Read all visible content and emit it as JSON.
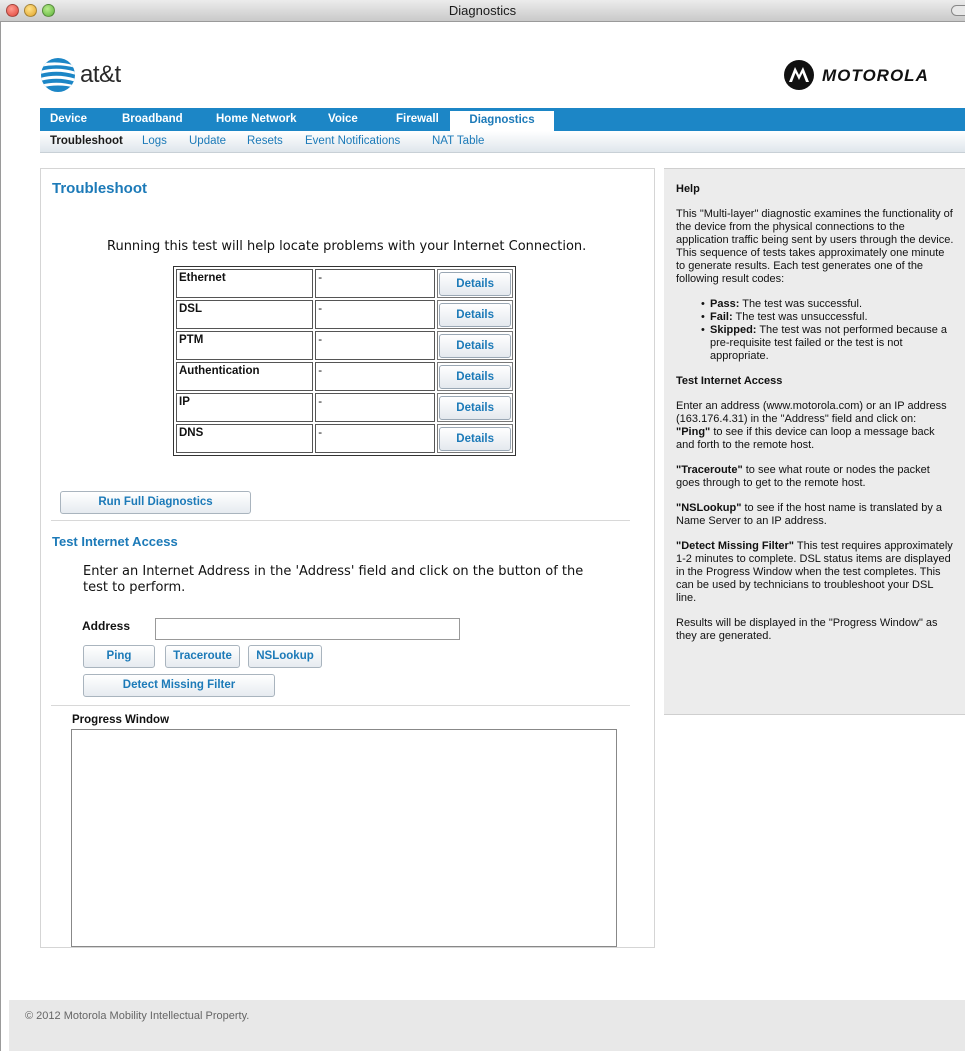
{
  "window": {
    "title": "Diagnostics"
  },
  "header": {
    "att_logo_text": "at&t",
    "motorola_logo_text": "MOTOROLA"
  },
  "nav": {
    "tabs": [
      {
        "label": "Device"
      },
      {
        "label": "Broadband"
      },
      {
        "label": "Home Network"
      },
      {
        "label": "Voice"
      },
      {
        "label": "Firewall"
      },
      {
        "label": "Diagnostics",
        "active": true
      }
    ],
    "subtabs": [
      {
        "label": "Troubleshoot",
        "active": true
      },
      {
        "label": "Logs"
      },
      {
        "label": "Update"
      },
      {
        "label": "Resets"
      },
      {
        "label": "Event Notifications"
      },
      {
        "label": "NAT Table"
      }
    ]
  },
  "main": {
    "title": "Troubleshoot",
    "intro": "Running this test will help locate problems with your Internet Connection.",
    "tests": [
      {
        "name": "Ethernet",
        "status": "-",
        "button": "Details"
      },
      {
        "name": "DSL",
        "status": "-",
        "button": "Details"
      },
      {
        "name": "PTM",
        "status": "-",
        "button": "Details"
      },
      {
        "name": "Authentication",
        "status": "-",
        "button": "Details"
      },
      {
        "name": "IP",
        "status": "-",
        "button": "Details"
      },
      {
        "name": "DNS",
        "status": "-",
        "button": "Details"
      }
    ],
    "run_full_label": "Run Full Diagnostics",
    "test_access": {
      "title": "Test Internet Access",
      "description": "Enter an Internet Address in the 'Address' field and click on the button of the test to perform.",
      "address_label": "Address",
      "address_value": "",
      "ping_label": "Ping",
      "traceroute_label": "Traceroute",
      "nslookup_label": "NSLookup",
      "detect_filter_label": "Detect Missing Filter"
    },
    "progress_label": "Progress Window",
    "progress_value": ""
  },
  "help": {
    "title": "Help",
    "intro": "This \"Multi-layer\" diagnostic examines the functionality of the device from the physical connections to the application traffic being sent by users through the device. This sequence of tests takes approximately one minute to generate results. Each test generates one of the following result codes:",
    "codes": [
      {
        "term": "Pass:",
        "desc": "The test was successful."
      },
      {
        "term": "Fail:",
        "desc": "The test was unsuccessful."
      },
      {
        "term": "Skipped:",
        "desc": "The test was not performed because a pre-requisite test failed or the test is not appropriate."
      }
    ],
    "test_title": "Test Internet Access",
    "test_intro": "Enter an address (www.motorola.com) or an IP address (163.176.4.31) in the \"Address\" field and click on:",
    "items": [
      {
        "term": "\"Ping\"",
        "desc": "to see if this device can loop a message back and forth to the remote host."
      },
      {
        "term": "\"Traceroute\"",
        "desc": "to see what route or nodes the packet goes through to get to the remote host."
      },
      {
        "term": "\"NSLookup\"",
        "desc": "to see if the host name is translated by a Name Server to an IP address."
      },
      {
        "term": "\"Detect Missing Filter\"",
        "desc": "This test requires approximately 1-2 minutes to complete. DSL status items are displayed in the Progress Window when the test completes. This can be used by technicians to troubleshoot your DSL line."
      }
    ],
    "results": "Results will be displayed in the \"Progress Window\" as they are generated."
  },
  "footer": {
    "text": "© 2012 Motorola Mobility Intellectual Property."
  }
}
